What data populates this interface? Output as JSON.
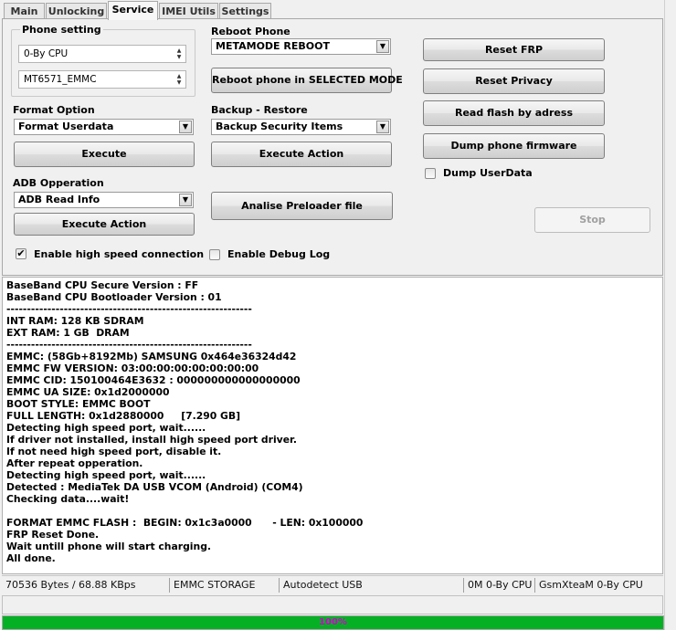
{
  "tabs": [
    {
      "label": "Main",
      "active": false
    },
    {
      "label": "Unlocking",
      "active": false
    },
    {
      "label": "Service",
      "active": true
    },
    {
      "label": "IMEI Utils",
      "active": false
    },
    {
      "label": "Settings",
      "active": false
    }
  ],
  "phone_setting": {
    "title": "Phone setting",
    "cpu_value": "0-By CPU",
    "storage_value": "MT6571_EMMC"
  },
  "reboot": {
    "title": "Reboot Phone",
    "mode_value": "METAMODE REBOOT",
    "button": "Reboot phone in SELECTED MODE"
  },
  "format": {
    "title": "Format Option",
    "value": "Format Userdata",
    "button": "Execute"
  },
  "backup": {
    "title": "Backup - Restore",
    "value": "Backup Security Items",
    "button": "Execute Action"
  },
  "adb": {
    "title": "ADB Opperation",
    "value": "ADB Read Info",
    "button": "Execute Action"
  },
  "preloader_button": "Analise Preloader file",
  "right_buttons": {
    "reset_frp": "Reset FRP",
    "reset_privacy": "Reset Privacy",
    "read_flash": "Read flash by adress",
    "dump_firmware": "Dump phone firmware",
    "dump_userdata": "Dump UserData",
    "stop": "Stop"
  },
  "options": {
    "high_speed": "Enable high speed connection",
    "high_speed_checked": true,
    "debug_log": "Enable Debug Log",
    "debug_log_checked": false
  },
  "log_lines": [
    "BaseBand CPU Secure Version : FF",
    "BaseBand CPU Bootloader Version : 01",
    "------------------------------------------------------------",
    "INT RAM: 128 KB SDRAM",
    "EXT RAM: 1 GB  DRAM",
    "------------------------------------------------------------",
    "EMMC: (58Gb+8192Mb) SAMSUNG 0x464e36324d42",
    "EMMC FW VERSION: 03:00:00:00:00:00:00:00",
    "EMMC CID: 150100464E3632 : 000000000000000000",
    "EMMC UA SIZE: 0x1d2000000",
    "BOOT STYLE: EMMC BOOT",
    "FULL LENGTH: 0x1d2880000     [7.290 GB]",
    "Detecting high speed port, wait......",
    "If driver not installed, install high speed port driver.",
    "If not need high speed port, disable it.",
    "After repeat opperation.",
    "Detecting high speed port, wait......",
    "Detected : MediaTek DA USB VCOM (Android) (COM4)",
    "Checking data....wait!",
    "",
    "FORMAT EMMC FLASH :  BEGIN: 0x1c3a0000      - LEN: 0x100000",
    "FRP Reset Done.",
    "Wait untill phone will start charging.",
    "All done."
  ],
  "status": {
    "bytes": "70536 Bytes / 68.88 KBps",
    "storage": "EMMC STORAGE",
    "usb": "Autodetect USB",
    "cpu": "0M 0-By CPU",
    "team": "GsmXteaM 0-By CPU"
  },
  "progress": {
    "text": "100%",
    "fraction": 1.0,
    "color": "#06b025"
  }
}
